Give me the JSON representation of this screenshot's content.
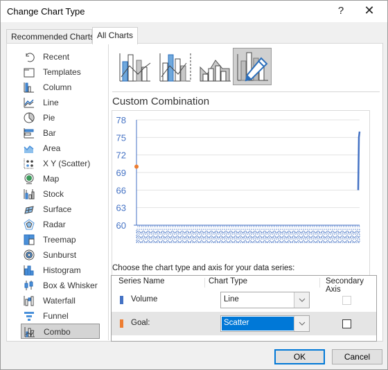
{
  "window": {
    "title": "Change Chart Type",
    "help_label": "?",
    "close_label": "✕"
  },
  "tabs": [
    {
      "label": "Recommended Charts",
      "active": false
    },
    {
      "label": "All Charts",
      "active": true
    }
  ],
  "sidebar": {
    "items": [
      {
        "label": "Recent",
        "icon": "recent-icon"
      },
      {
        "label": "Templates",
        "icon": "templates-icon"
      },
      {
        "label": "Column",
        "icon": "column-chart-icon"
      },
      {
        "label": "Line",
        "icon": "line-chart-icon"
      },
      {
        "label": "Pie",
        "icon": "pie-chart-icon"
      },
      {
        "label": "Bar",
        "icon": "bar-chart-icon"
      },
      {
        "label": "Area",
        "icon": "area-chart-icon"
      },
      {
        "label": "X Y (Scatter)",
        "icon": "scatter-chart-icon"
      },
      {
        "label": "Map",
        "icon": "map-chart-icon"
      },
      {
        "label": "Stock",
        "icon": "stock-chart-icon"
      },
      {
        "label": "Surface",
        "icon": "surface-chart-icon"
      },
      {
        "label": "Radar",
        "icon": "radar-chart-icon"
      },
      {
        "label": "Treemap",
        "icon": "treemap-chart-icon"
      },
      {
        "label": "Sunburst",
        "icon": "sunburst-chart-icon"
      },
      {
        "label": "Histogram",
        "icon": "histogram-chart-icon"
      },
      {
        "label": "Box & Whisker",
        "icon": "box-whisker-chart-icon"
      },
      {
        "label": "Waterfall",
        "icon": "waterfall-chart-icon"
      },
      {
        "label": "Funnel",
        "icon": "funnel-chart-icon"
      },
      {
        "label": "Combo",
        "icon": "combo-chart-icon",
        "selected": true
      }
    ]
  },
  "subtypes": [
    {
      "name": "clustered-column-line",
      "selected": false
    },
    {
      "name": "clustered-column-line-secondary-axis",
      "selected": false
    },
    {
      "name": "stacked-area-clustered-column",
      "selected": false
    },
    {
      "name": "custom-combination",
      "selected": true
    }
  ],
  "section_title": "Custom Combination",
  "colors": {
    "volume": "#4472c4",
    "goal": "#ed7d31",
    "accent": "#0078d7",
    "axis_text": "#4472c4"
  },
  "chart_data": {
    "type": "line",
    "title": "",
    "ylim": [
      60,
      78
    ],
    "yticks": [
      "78",
      "75",
      "72",
      "69",
      "66",
      "63",
      "60"
    ],
    "grid": true,
    "legend": "none",
    "x_labels_note": "dense overlapping date category labels (unreadable)",
    "series": [
      {
        "name": "Volume",
        "type": "line",
        "values": [
          66,
          75,
          76
        ],
        "position": "right-edge"
      },
      {
        "name": "Goal:",
        "type": "scatter",
        "values": [
          70
        ],
        "position": "left-edge"
      }
    ]
  },
  "series_section": {
    "caption": "Choose the chart type and axis for your data series:",
    "headers": {
      "name": "Series Name",
      "type": "Chart Type",
      "axis": "Secondary Axis"
    },
    "rows": [
      {
        "name": "Volume",
        "chart_type": "Line",
        "secondary_axis": false,
        "secondary_enabled": false
      },
      {
        "name": "Goal:",
        "chart_type": "Scatter",
        "secondary_axis": false,
        "secondary_enabled": true
      }
    ]
  },
  "buttons": {
    "ok": "OK",
    "cancel": "Cancel"
  }
}
